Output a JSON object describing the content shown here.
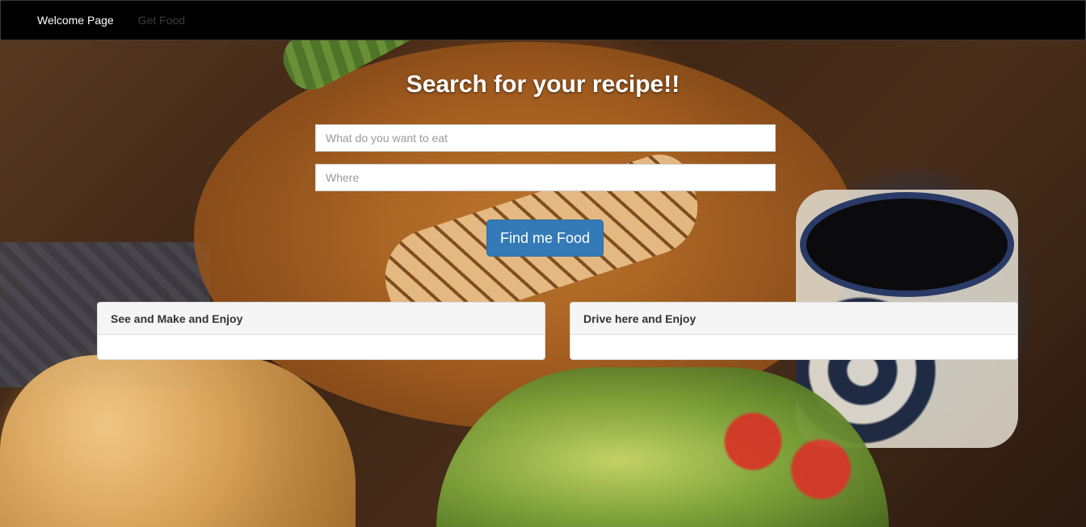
{
  "navbar": {
    "brand": "Welcome Page",
    "links": [
      {
        "label": "Get Food"
      }
    ]
  },
  "hero": {
    "title": "Search for your recipe!!"
  },
  "search": {
    "what_placeholder": "What do you want to eat",
    "what_value": "",
    "where_placeholder": "Where",
    "where_value": "",
    "button_label": "Find me Food"
  },
  "panels": [
    {
      "heading": "See and Make and Enjoy",
      "body": ""
    },
    {
      "heading": "Drive here and Enjoy",
      "body": ""
    }
  ],
  "colors": {
    "navbar_bg": "#000000",
    "button_primary": "#337ab7",
    "panel_heading_bg": "#f5f5f5",
    "title_text": "#ffffff"
  },
  "background": {
    "icon": "food-photo-background"
  }
}
